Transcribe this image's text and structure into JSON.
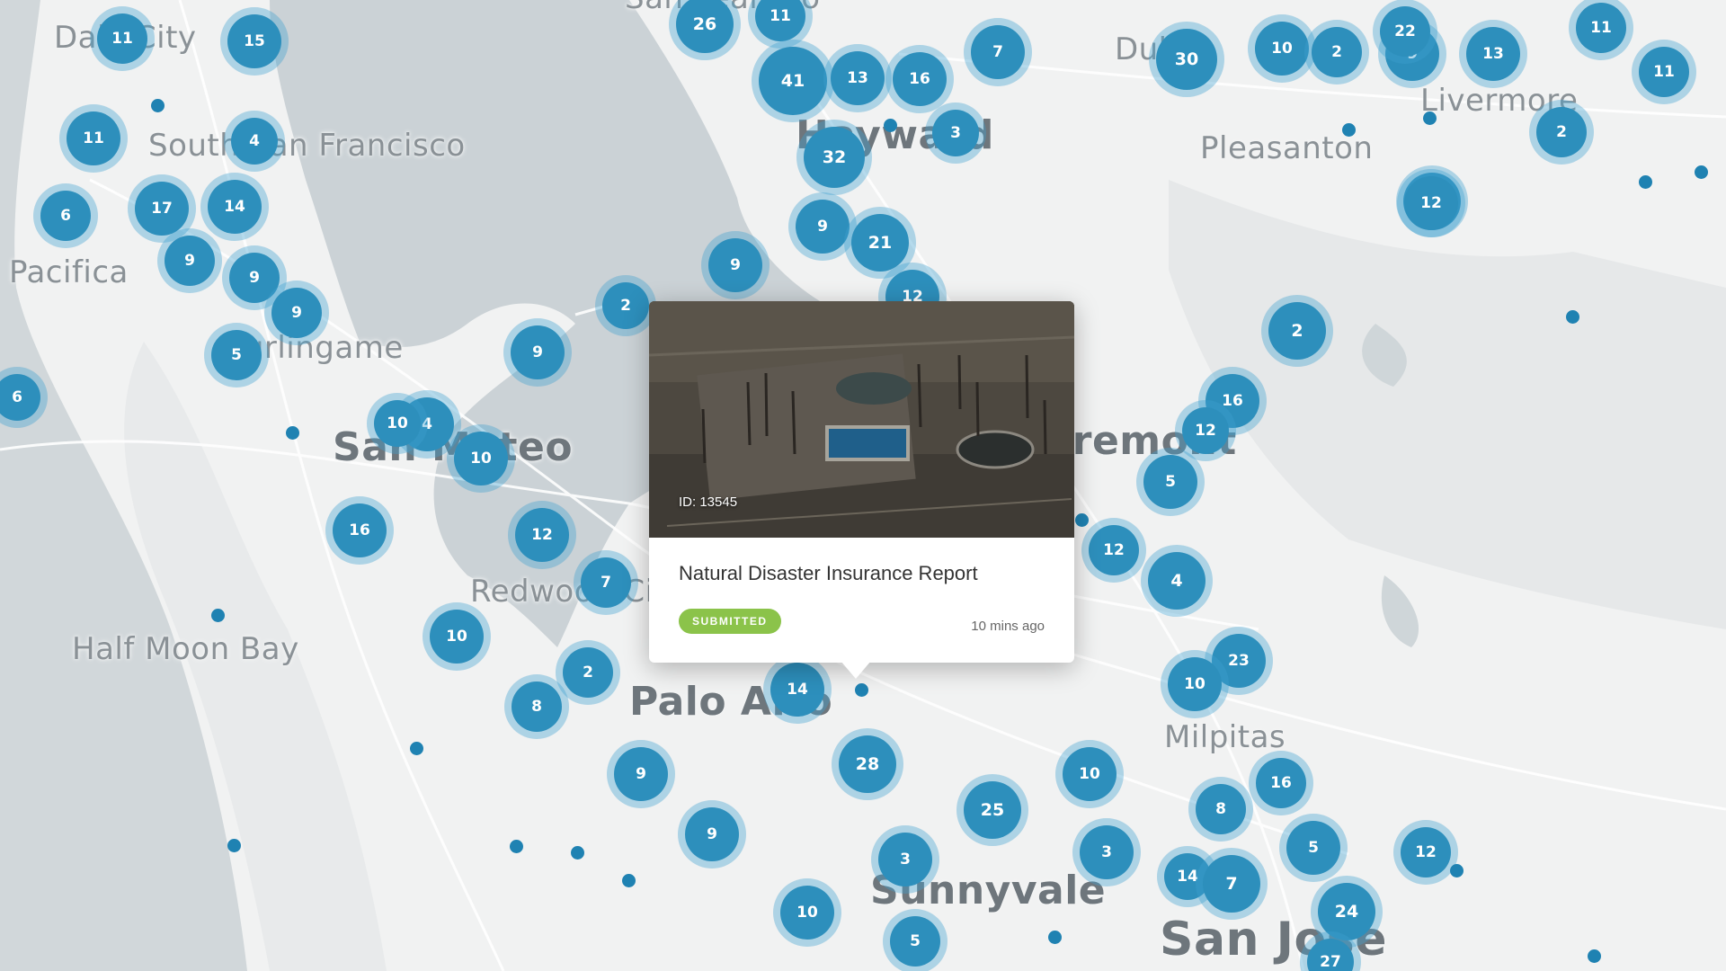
{
  "map": {
    "places": [
      {
        "name": "Daly City",
        "size": "small"
      },
      {
        "name": "South San Francisco",
        "size": "small"
      },
      {
        "name": "Pacifica",
        "size": "small"
      },
      {
        "name": "Burlingame",
        "size": "small"
      },
      {
        "name": "San Mateo",
        "size": "big"
      },
      {
        "name": "Redwood City",
        "size": "small"
      },
      {
        "name": "Half Moon Bay",
        "size": "small"
      },
      {
        "name": "Palo Alto",
        "size": "big"
      },
      {
        "name": "Hayward",
        "size": "big"
      },
      {
        "name": "Dublin",
        "size": "small"
      },
      {
        "name": "Pleasanton",
        "size": "small"
      },
      {
        "name": "Livermore",
        "size": "small"
      },
      {
        "name": "Fremont",
        "size": "big"
      },
      {
        "name": "Milpitas",
        "size": "small"
      },
      {
        "name": "Sunnyvale",
        "size": "big"
      },
      {
        "name": "San Jose",
        "size": "big"
      },
      {
        "name": "San Leandro",
        "size": "small"
      }
    ],
    "clusters": [
      26,
      11,
      41,
      13,
      16,
      7,
      32,
      3,
      9,
      21,
      12,
      9,
      30,
      10,
      2,
      9,
      13,
      11,
      11,
      2,
      3,
      12,
      2,
      16,
      12,
      5,
      12,
      4,
      23,
      10,
      10,
      16,
      8,
      5,
      12,
      3,
      14,
      7,
      24,
      27,
      22,
      11,
      15,
      11,
      4,
      17,
      14,
      6,
      9,
      9,
      9,
      5,
      6,
      4,
      10,
      10,
      9,
      2,
      16,
      12,
      7,
      10,
      2,
      8,
      14,
      9,
      9,
      28,
      25,
      3,
      10,
      5
    ],
    "point_count": 19
  },
  "popup": {
    "id_label": "ID: 13545",
    "title": "Natural Disaster Insurance Report",
    "status": "SUBMITTED",
    "time": "10 mins ago"
  },
  "colors": {
    "cluster": "#2d8fbc",
    "cluster_halo": "#3ea0d0",
    "land": "#f1f2f2",
    "water": "#ccd3d6",
    "status_badge": "#8bc34a"
  }
}
